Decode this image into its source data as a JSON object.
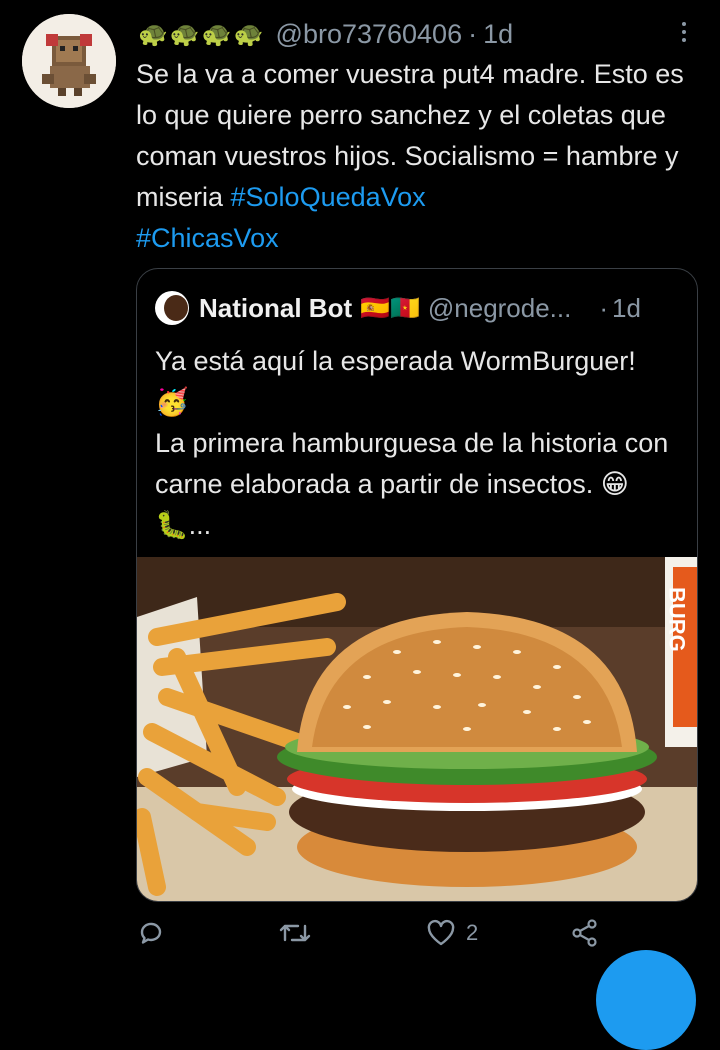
{
  "tweet": {
    "display_name": "🐢🐢🐢🐢",
    "handle": "@bro73760406",
    "separator": "·",
    "time": "1d",
    "text_main": "Se la va a comer vuestra put4 madre. Esto es lo que quiere perro sanchez y el coletas que coman vuestros hijos. Socialismo = hambre y miseria ",
    "hashtag1": "#SoloQuedaVox",
    "hashtag2": "#ChicasVox"
  },
  "quote": {
    "name": "National Bot",
    "flags": "🇪🇸🇨🇲",
    "handle": "@negrode...",
    "separator": "·",
    "time": "1d",
    "text": "Ya está aquí la esperada WormBurguer!\n🥳\nLa primera hamburguesa de la historia con carne elaborada a partir de insectos. 😁🐛...",
    "image_icon": "burger-photo",
    "cup_text": "BURG"
  },
  "actions": {
    "reply_icon": "reply-icon",
    "retweet_icon": "retweet-icon",
    "like_icon": "heart-icon",
    "like_count": "2",
    "share_icon": "share-icon"
  },
  "colors": {
    "background": "#000000",
    "text": "#e7e7e7",
    "secondary": "#8b98a5",
    "link": "#1d9bf0"
  }
}
